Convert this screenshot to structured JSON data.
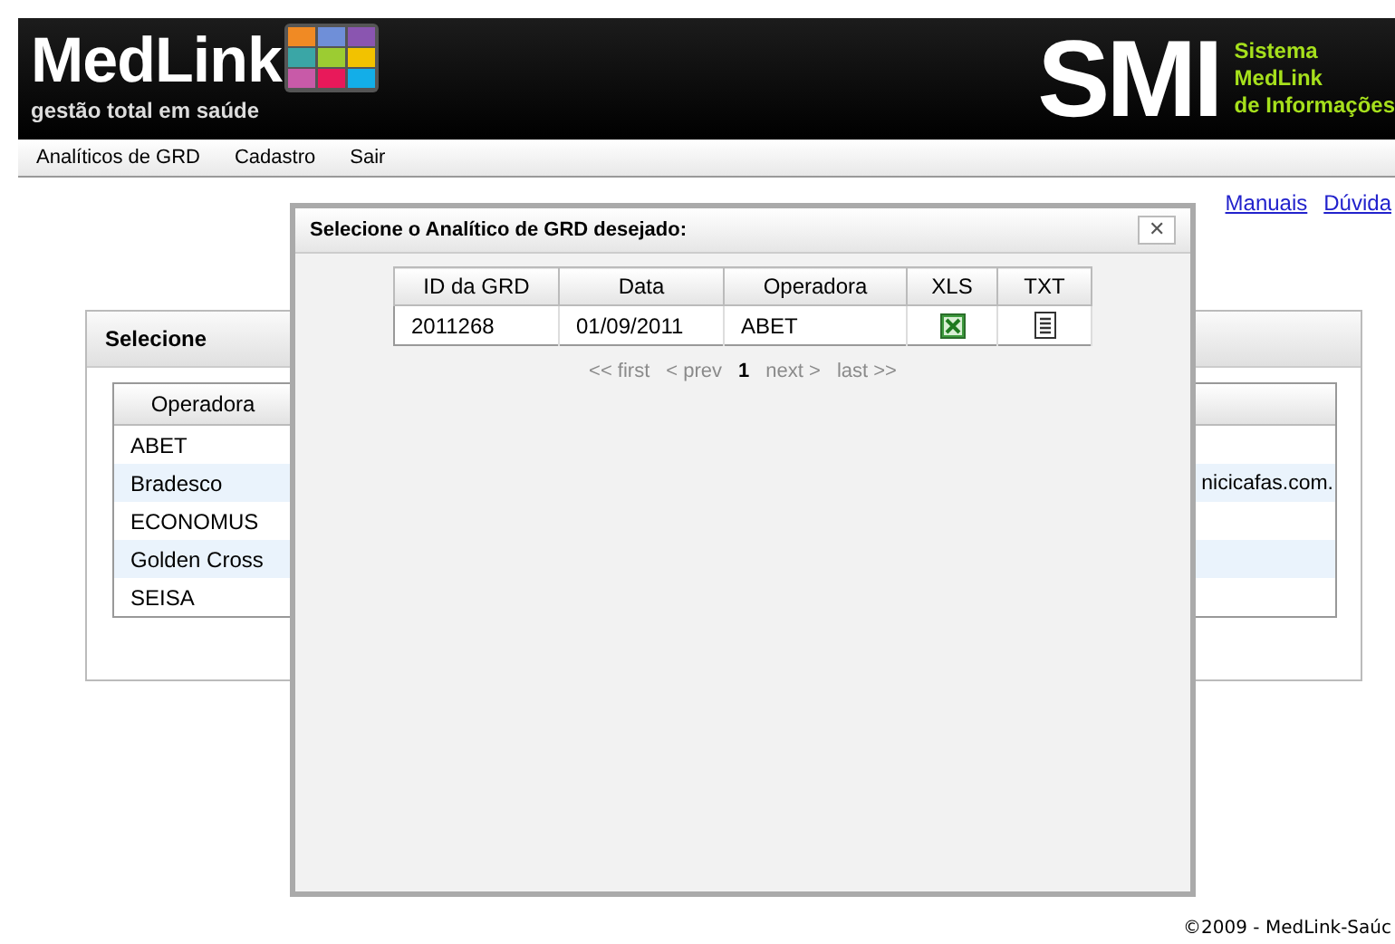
{
  "header": {
    "logo": "MedLink",
    "tagline": "gestão total em saúde",
    "system_mark": "SMI",
    "system_name": [
      "Sistema",
      "MedLink",
      "de Informações"
    ]
  },
  "menu": [
    "Analíticos de GRD",
    "Cadastro",
    "Sair"
  ],
  "links": [
    "Manuais",
    "Dúvida"
  ],
  "panel": {
    "title": "Selecione",
    "columns": [
      "Operadora"
    ],
    "rows": [
      {
        "operadora": "ABET"
      },
      {
        "operadora": "Bradesco",
        "column_2": "nicicafas.com."
      },
      {
        "operadora": "ECONOMUS"
      },
      {
        "operadora": "Golden Cross"
      },
      {
        "operadora": "SEISA"
      }
    ]
  },
  "dialog": {
    "title": "Selecione o Analítico de GRD desejado:",
    "close": "✕",
    "columns": [
      "ID da GRD",
      "Data",
      "Operadora",
      "XLS",
      "TXT"
    ],
    "rows": [
      {
        "id": "2011268",
        "data": "01/09/2011",
        "operadora": "ABET"
      }
    ],
    "pager": [
      {
        "label": "<< first",
        "selected": false,
        "disabled": true
      },
      {
        "label": "< prev",
        "selected": false,
        "disabled": true
      },
      {
        "label": "1",
        "selected": true,
        "disabled": false
      },
      {
        "label": "next >",
        "selected": false,
        "disabled": true
      },
      {
        "label": "last >>",
        "selected": false,
        "disabled": true
      }
    ]
  },
  "footer": "©2009 - MedLink-Saúc"
}
